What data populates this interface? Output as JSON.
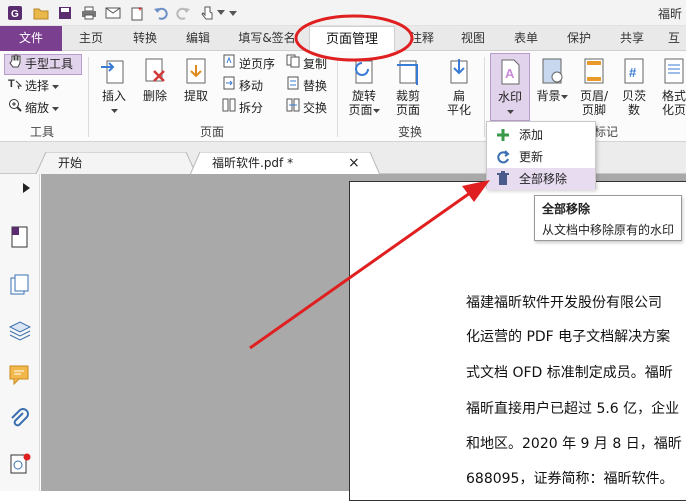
{
  "window": {
    "title": "福昕"
  },
  "menu_tabs": [
    "文件",
    "主页",
    "转换",
    "编辑",
    "填写&签名",
    "页面管理",
    "注释",
    "视图",
    "表单",
    "保护",
    "共享",
    "互"
  ],
  "active_tab": "页面管理",
  "tools_group": {
    "hand_tool": "手型工具",
    "select": "选择",
    "zoom": "缩放",
    "label": "工具"
  },
  "pages_group": {
    "insert": "插入",
    "delete": "删除",
    "extract": "提取",
    "reverse": "逆页序",
    "move": "移动",
    "split": "拆分",
    "copy": "复制",
    "replace": "替换",
    "swap": "交换",
    "label": "页面"
  },
  "transform_group": {
    "rotate": [
      "旋转",
      "页面"
    ],
    "crop": [
      "裁剪",
      "页面"
    ],
    "flatten": [
      "扁",
      "平化"
    ],
    "label": "变换"
  },
  "watermark_group": {
    "watermark": "水印",
    "background": "背景",
    "header_footer": [
      "页眉/",
      "页脚"
    ],
    "bates": [
      "贝茨",
      "数"
    ],
    "format": [
      "格式",
      "化页"
    ],
    "label": "标记"
  },
  "watermark_menu": {
    "add": "添加",
    "update": "更新",
    "remove_all": "全部移除"
  },
  "tooltip": {
    "title": "全部移除",
    "desc": "从文档中移除原有的水印"
  },
  "doc_tabs": {
    "start": "开始",
    "file": "福昕软件.pdf *",
    "close": "×"
  },
  "document_lines": [
    "福建福昕软件开发股份有限公司",
    "化运营的 PDF 电子文档解决方案",
    "式文档 OFD 标准制定成员。福昕",
    "福昕直接用户已超过 5.6 亿，企业",
    "和地区。2020 年 9 月 8 日，福昕",
    "688095，证券简称：福昕软件。"
  ],
  "colors": {
    "accent": "#7b3f8f",
    "annotation": "#e02020"
  }
}
